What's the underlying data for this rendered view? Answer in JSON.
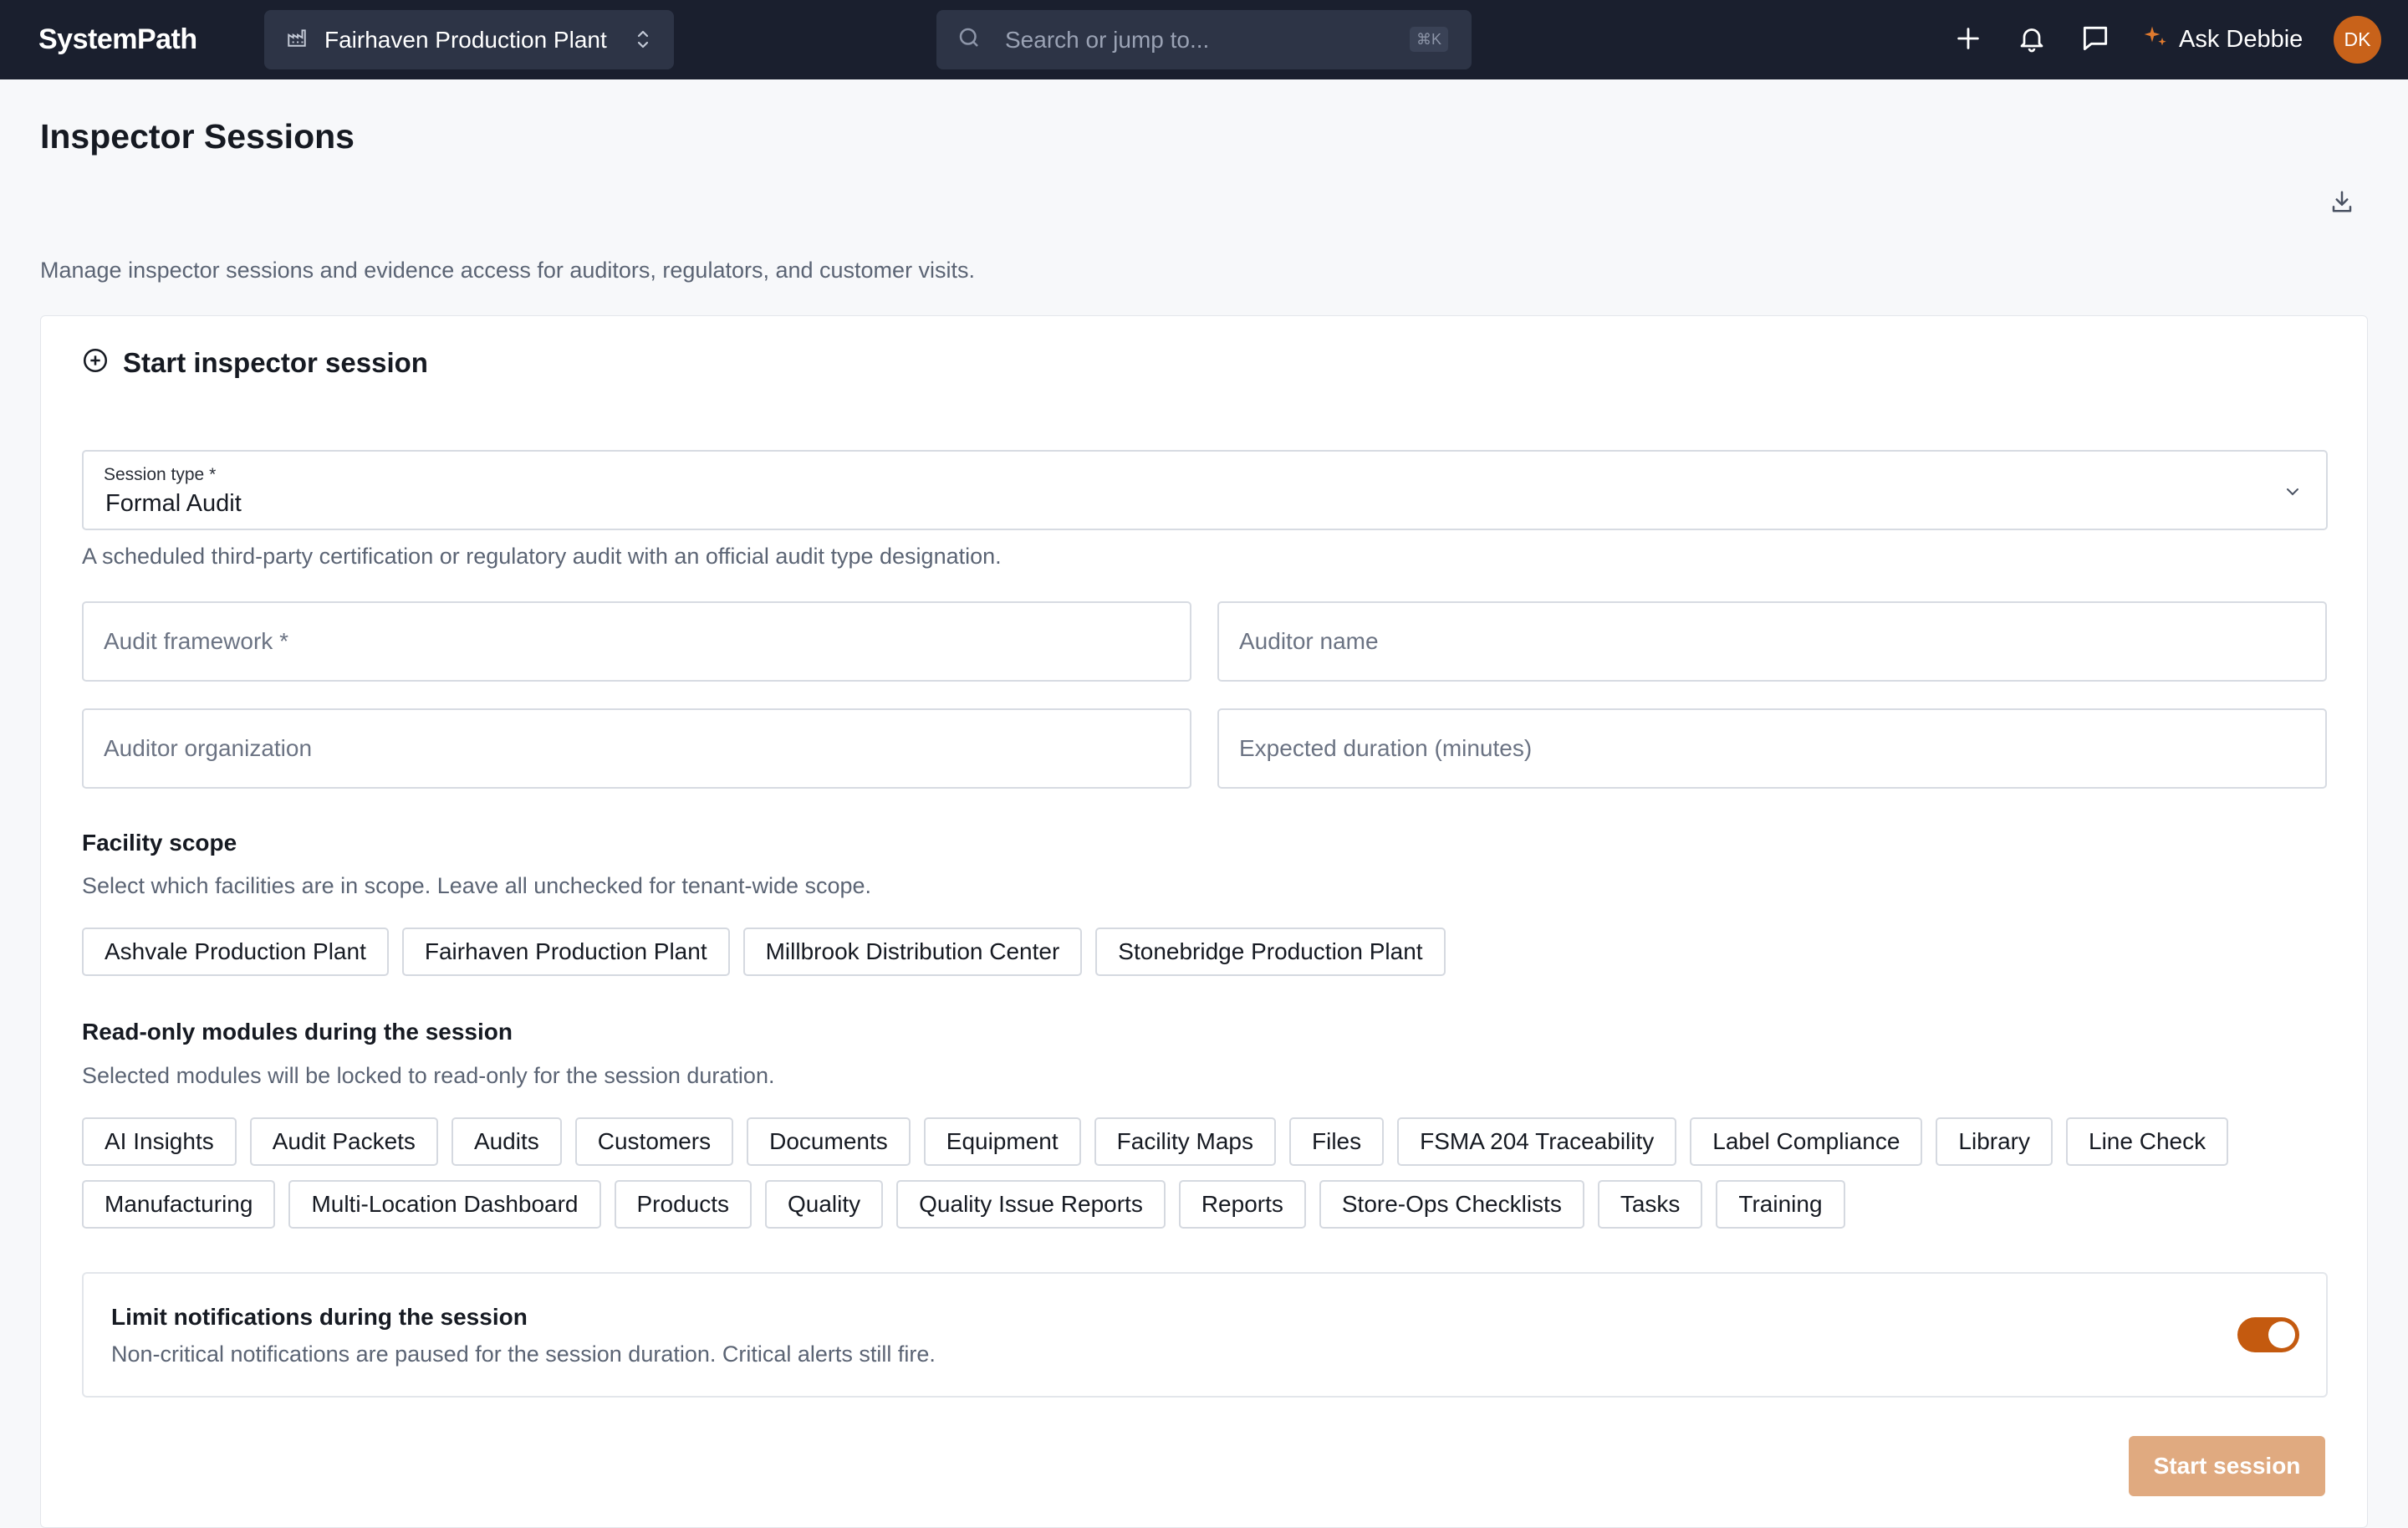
{
  "app": {
    "name": "SystemPath"
  },
  "header": {
    "site": "Fairhaven Production Plant",
    "search_placeholder": "Search or jump to...",
    "search_shortcut": "⌘K",
    "ask_label": "Ask Debbie",
    "avatar_initials": "DK"
  },
  "page": {
    "title": "Inspector Sessions",
    "description": "Manage inspector sessions and evidence access for auditors, regulators, and customer visits."
  },
  "form": {
    "heading": "Start inspector session",
    "session_type": {
      "label": "Session type *",
      "value": "Formal Audit",
      "helper": "A scheduled third-party certification or regulatory audit with an official audit type designation."
    },
    "fields": {
      "audit_framework": "Audit framework *",
      "auditor_name": "Auditor name",
      "auditor_organization": "Auditor organization",
      "expected_duration": "Expected duration (minutes)"
    },
    "facility_scope": {
      "title": "Facility scope",
      "subtitle": "Select which facilities are in scope. Leave all unchecked for tenant-wide scope.",
      "options": [
        "Ashvale Production Plant",
        "Fairhaven Production Plant",
        "Millbrook Distribution Center",
        "Stonebridge Production Plant"
      ]
    },
    "modules": {
      "title": "Read-only modules during the session",
      "subtitle": "Selected modules will be locked to read-only for the session duration.",
      "options": [
        "AI Insights",
        "Audit Packets",
        "Audits",
        "Customers",
        "Documents",
        "Equipment",
        "Facility Maps",
        "Files",
        "FSMA 204 Traceability",
        "Label Compliance",
        "Library",
        "Line Check",
        "Manufacturing",
        "Multi-Location Dashboard",
        "Products",
        "Quality",
        "Quality Issue Reports",
        "Reports",
        "Store-Ops Checklists",
        "Tasks",
        "Training"
      ]
    },
    "notifications": {
      "title": "Limit notifications during the session",
      "subtitle": "Non-critical notifications are paused for the session duration. Critical alerts still fire.",
      "enabled": true
    },
    "submit_label": "Start session"
  },
  "colors": {
    "topbar": "#1a1f2e",
    "accent": "#c45a0f",
    "button_disabled": "#e0aa80"
  }
}
